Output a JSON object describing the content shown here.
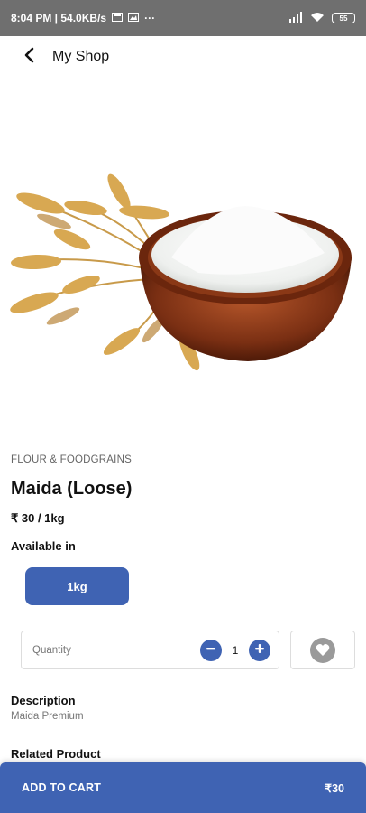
{
  "status_bar": {
    "time_network": "8:04 PM | 54.0KB/s",
    "more": "···",
    "battery": "55"
  },
  "header": {
    "title": "My Shop"
  },
  "product": {
    "category": "FLOUR & FOODGRAINS",
    "name": "Maida (Loose)",
    "price": "₹ 30 / 1kg",
    "available_label": "Available in",
    "variants": [
      "1kg"
    ],
    "selected_variant": "1kg"
  },
  "quantity": {
    "label": "Quantity",
    "value": "1"
  },
  "description": {
    "title": "Description",
    "text": "Maida Premium"
  },
  "related": {
    "title": "Related Product"
  },
  "cart": {
    "label": "ADD TO CART",
    "total": "₹30"
  },
  "colors": {
    "accent": "#3f63b3",
    "status_bar": "#6f6f6f",
    "wishlist_icon": "#9a9a9a"
  },
  "icons": {
    "back": "chevron-left-icon",
    "minus": "minus-circle-icon",
    "plus": "plus-circle-icon",
    "wishlist": "heart-icon"
  }
}
